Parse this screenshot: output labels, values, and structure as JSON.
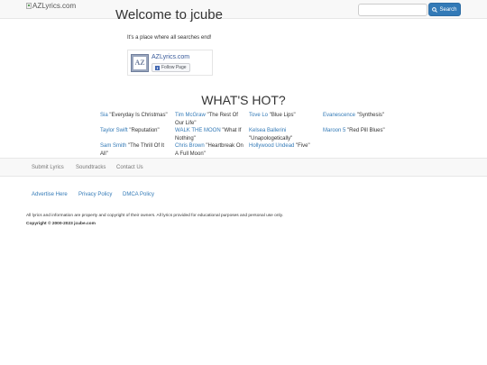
{
  "header": {
    "logo_alt": "AZLyrics.com",
    "search_placeholder": "",
    "search_button_label": "Search"
  },
  "intro": {
    "welcome_text": "Welcome to jcube",
    "tagline": "It's a place where all searches end!"
  },
  "facebook_widget": {
    "page_name": "AZLyrics.com",
    "follow_label": "Follow Page"
  },
  "whats_hot": {
    "title": "WHAT'S HOT?",
    "items": [
      {
        "artist": "Sia",
        "song": "\"Everyday Is Christmas\""
      },
      {
        "artist": "Tim McGraw",
        "song": "\"The Rest Of Our Life\""
      },
      {
        "artist": "Tove Lo",
        "song": "\"Blue Lips\""
      },
      {
        "artist": "Evanescence",
        "song": "\"Synthesis\""
      },
      {
        "artist": "Taylor Swift",
        "song": "\"Reputation\""
      },
      {
        "artist": "WALK THE MOON",
        "song": "\"What If Nothing\""
      },
      {
        "artist": "Kelsea Ballerini",
        "song": "\"Unapologetically\""
      },
      {
        "artist": "Maroon 5",
        "song": "\"Red Pill Blues\""
      },
      {
        "artist": "Sam Smith",
        "song": "\"The Thrill Of It All\""
      },
      {
        "artist": "Chris Brown",
        "song": "\"Heartbreak On A Full Moon\""
      },
      {
        "artist": "Hollywood Undead",
        "song": "\"Five\""
      }
    ]
  },
  "footer_nav": {
    "items": [
      "Submit Lyrics",
      "Soundtracks",
      "Contact Us"
    ]
  },
  "footer_links": {
    "items": [
      "Advertise Here",
      "Privacy Policy",
      "DMCA Policy"
    ]
  },
  "footer": {
    "disclaimer": "All lyrics and information are property and copyright of their owners. All lyrics provided for educational purposes and personal use only.",
    "copyright": "Copyright © 2000-2023 jcube.com"
  }
}
